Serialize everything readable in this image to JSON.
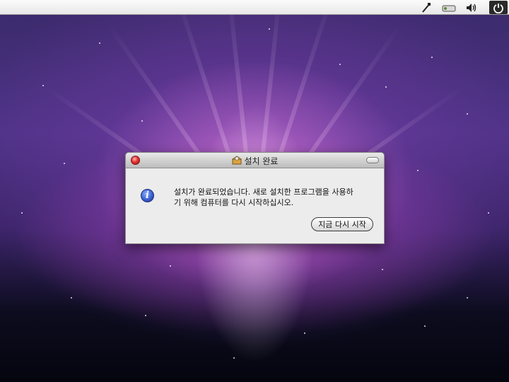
{
  "menubar": {
    "icons": [
      "network-cable-icon",
      "drive-icon",
      "volume-icon",
      "power-icon"
    ]
  },
  "dialog": {
    "title": "설치 완료",
    "title_icon": "installer-box-icon",
    "message": "설치가 완료되었습니다. 새로 설치한 프로그램을 사용하\n기 위해 컴퓨터를 다시 시작하십시오.",
    "restart_button_label": "지금 다시 시작",
    "info_icon_glyph": "i"
  },
  "colors": {
    "close_button": "#e8332f",
    "info_icon": "#3a5fd0",
    "dialog_background": "#ececec"
  }
}
